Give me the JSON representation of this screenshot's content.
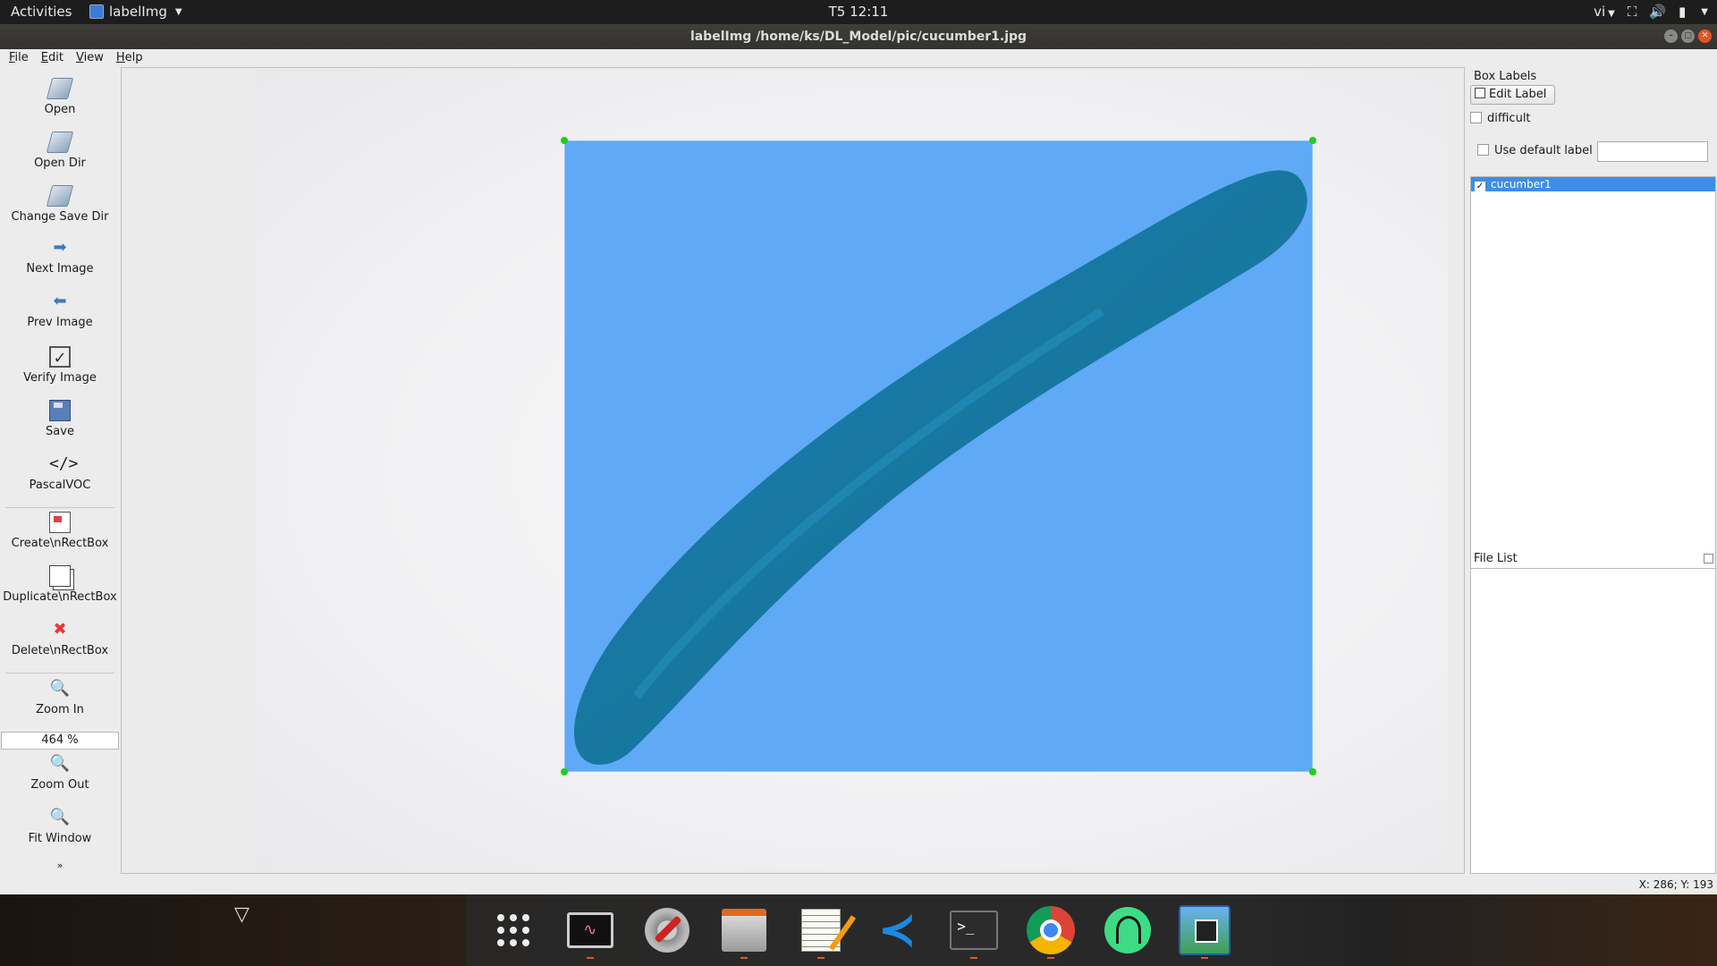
{
  "topbar": {
    "activities": "Activities",
    "app_name": "labelImg",
    "clock": "T5 12:11",
    "input_method": "vi"
  },
  "window": {
    "title": "labelImg /home/ks/DL_Model/pic/cucumber1.jpg"
  },
  "menu": {
    "file": "File",
    "edit": "Edit",
    "view": "View",
    "help": "Help"
  },
  "toolbar": {
    "open": "Open",
    "open_dir": "Open Dir",
    "change_save_dir": "Change Save Dir",
    "next_image": "Next Image",
    "prev_image": "Prev Image",
    "verify_image": "Verify Image",
    "save": "Save",
    "format_icon": "</>",
    "format": "PascalVOC",
    "create_rect": "Create\\nRectBox",
    "duplicate_rect": "Duplicate\\nRectBox",
    "delete_rect": "Delete\\nRectBox",
    "zoom_in": "Zoom In",
    "zoom_value": "464 %",
    "zoom_out": "Zoom Out",
    "fit_window": "Fit Window",
    "more": "»"
  },
  "box_labels": {
    "title": "Box Labels",
    "edit_label": "Edit Label",
    "difficult": "difficult",
    "use_default_label": "Use default label",
    "default_label_value": "",
    "items": [
      {
        "label": "cucumber1",
        "checked": true
      }
    ]
  },
  "file_list": {
    "title": "File List",
    "items": []
  },
  "status": {
    "coords": "X: 286; Y: 193"
  },
  "colors": {
    "bbox_fill": "#5fa9f6",
    "handle": "#1ad11a",
    "selection": "#3d8ee6"
  }
}
